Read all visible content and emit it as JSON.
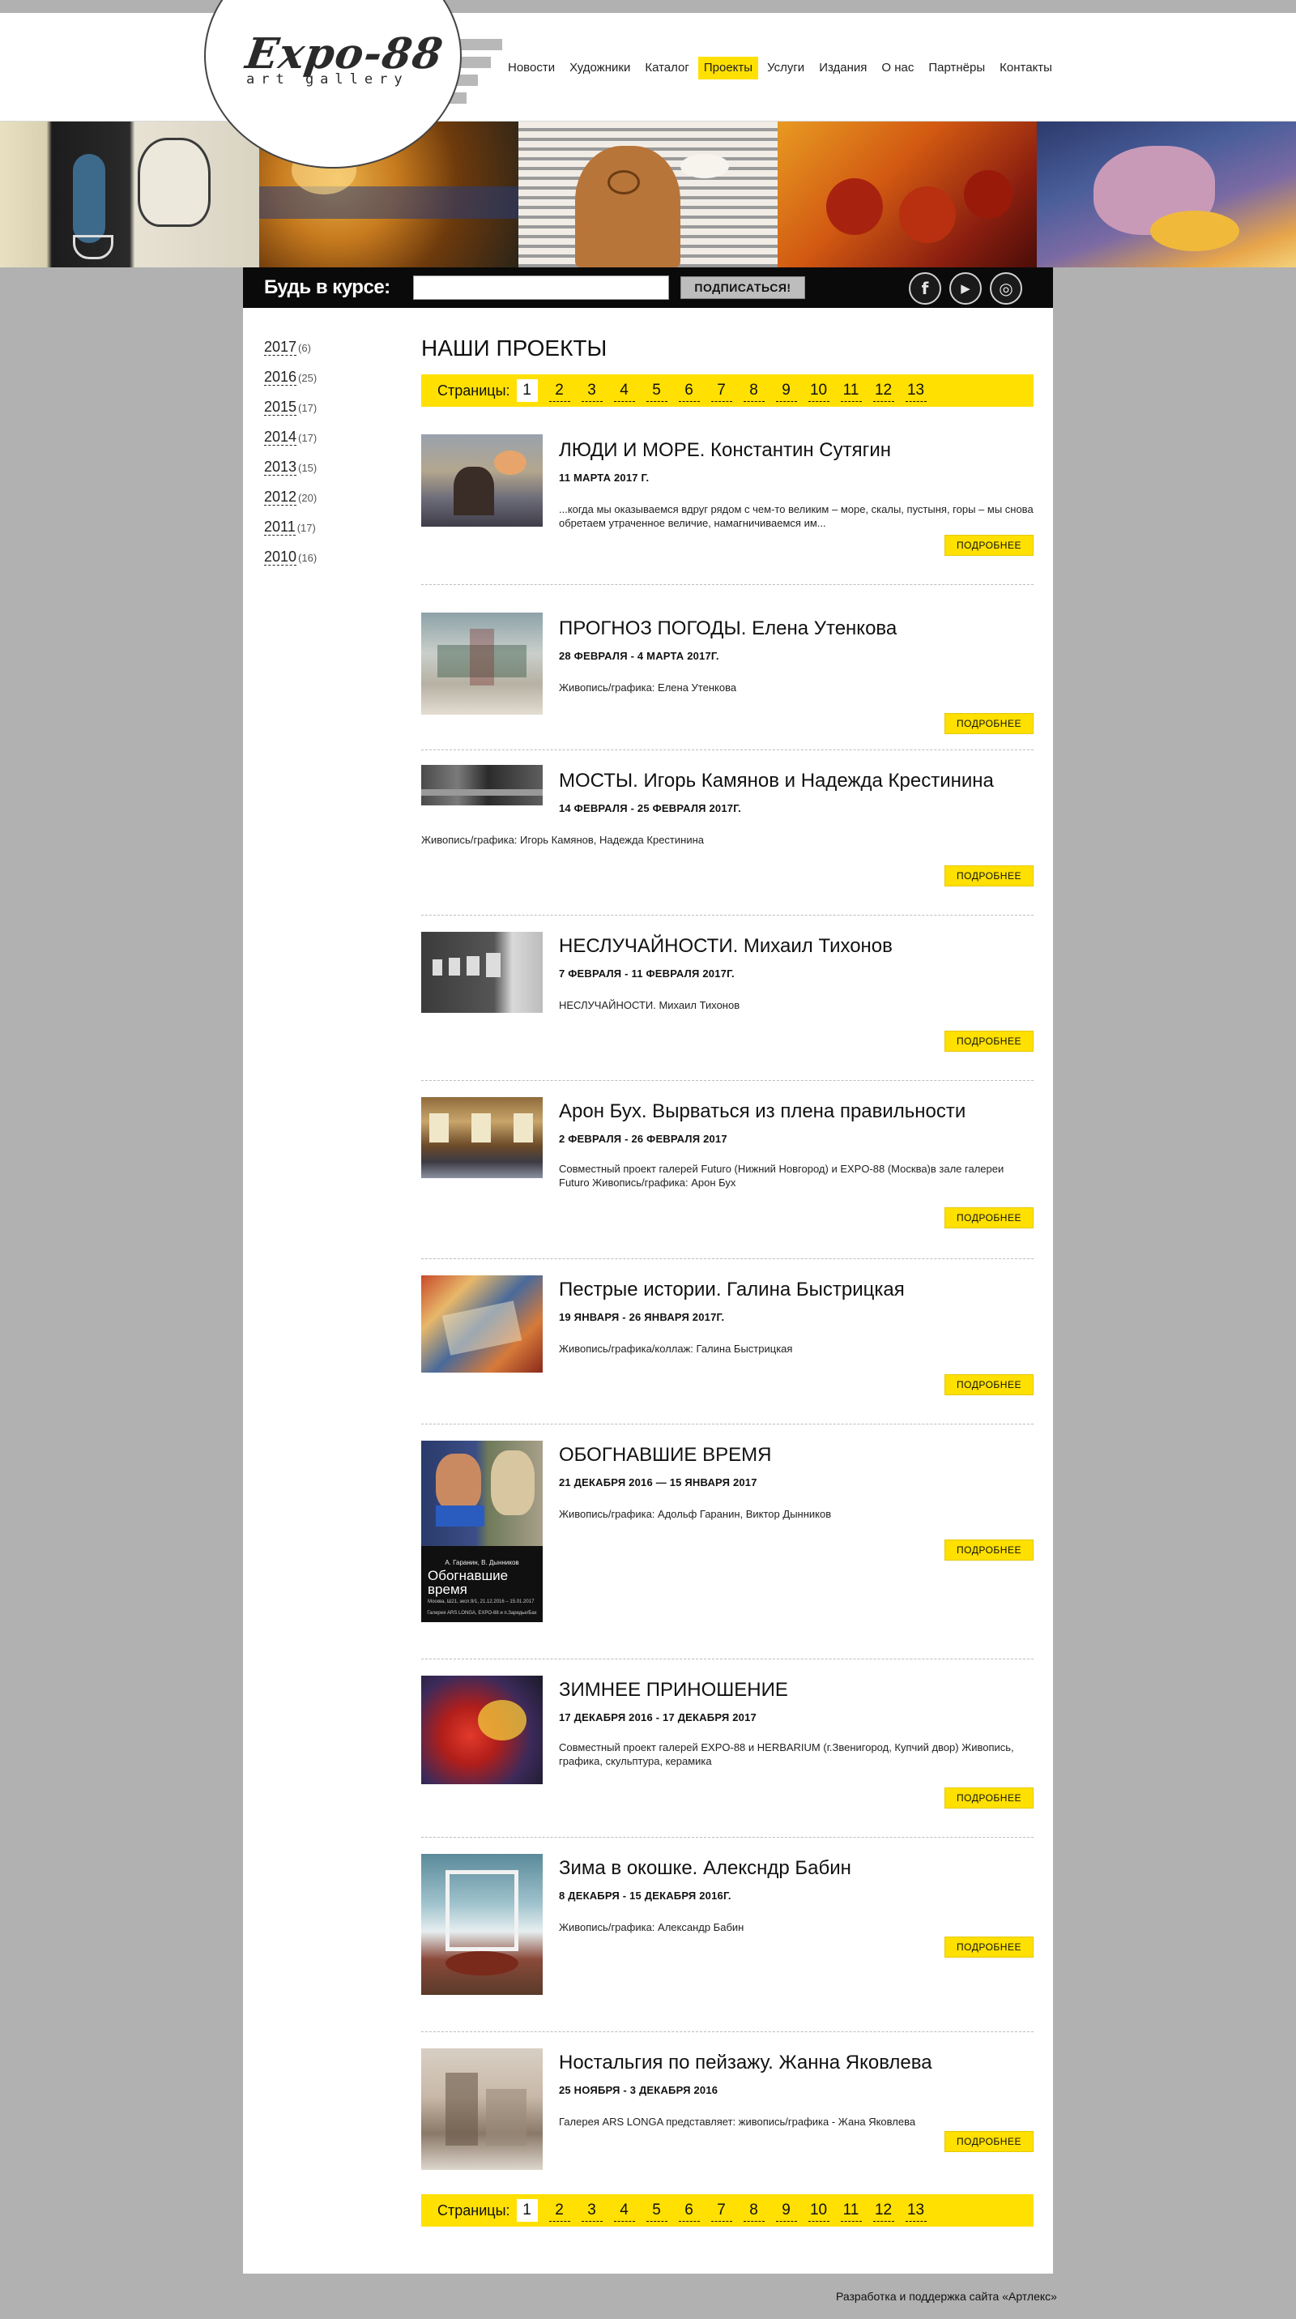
{
  "header": {
    "logo_text": "Expo-88",
    "logo_sub": "art gallery",
    "nav": [
      {
        "label": "Новости",
        "active": false
      },
      {
        "label": "Художники",
        "active": false
      },
      {
        "label": "Каталог",
        "active": false
      },
      {
        "label": "Проекты",
        "active": true
      },
      {
        "label": "Услуги",
        "active": false
      },
      {
        "label": "Издания",
        "active": false
      },
      {
        "label": "О нас",
        "active": false
      },
      {
        "label": "Партнёры",
        "active": false
      },
      {
        "label": "Контакты",
        "active": false
      }
    ]
  },
  "subscribe": {
    "label": "Будь в курсе:",
    "input_value": "",
    "button_label": "ПОДПИСАТЬСЯ!",
    "social": [
      {
        "icon": "facebook-icon",
        "glyph": "f"
      },
      {
        "icon": "youtube-icon",
        "glyph": "▶"
      },
      {
        "icon": "instagram-icon",
        "glyph": "◎"
      }
    ]
  },
  "sidebar": {
    "years": [
      {
        "year": "2017",
        "count": "(6)"
      },
      {
        "year": "2016",
        "count": "(25)"
      },
      {
        "year": "2015",
        "count": "(17)"
      },
      {
        "year": "2014",
        "count": "(17)"
      },
      {
        "year": "2013",
        "count": "(15)"
      },
      {
        "year": "2012",
        "count": "(20)"
      },
      {
        "year": "2011",
        "count": "(17)"
      },
      {
        "year": "2010",
        "count": "(16)"
      }
    ]
  },
  "main": {
    "title": "НАШИ ПРОЕКТЫ",
    "pager": {
      "label": "Страницы:",
      "pages": [
        "1",
        "2",
        "3",
        "4",
        "5",
        "6",
        "7",
        "8",
        "9",
        "10",
        "11",
        "12",
        "13"
      ],
      "current": "1"
    },
    "more_label": "ПОДРОБНЕЕ",
    "projects": [
      {
        "title": "ЛЮДИ И МОРЕ. Константин Сутягин",
        "date": "11 МАРТА 2017 Г.",
        "desc": "...когда мы оказываемся вдруг рядом с чем-то великим – море, скалы, пустыня, горы – мы снова обретаем утраченное величие, намагничиваемся им..."
      },
      {
        "title": "ПРОГНОЗ ПОГОДЫ. Елена Утенкова",
        "date": "28 ФЕВРАЛЯ - 4 МАРТА 2017Г.",
        "desc": "Живопись/графика: Елена Утенкова"
      },
      {
        "title": "МОСТЫ. Игорь Камянов и Надежда Крестинина",
        "date": "14 ФЕВРАЛЯ - 25 ФЕВРАЛЯ 2017Г.",
        "desc": "Живопись/графика: Игорь Камянов, Надежда Крестинина"
      },
      {
        "title": "НЕСЛУЧАЙНОСТИ. Михаил Тихонов",
        "date": "7 ФЕВРАЛЯ - 11 ФЕВРАЛЯ 2017Г.",
        "desc": "НЕСЛУЧАЙНОСТИ. Михаил Тихонов"
      },
      {
        "title": "Арон Бух. Вырваться из плена правильности",
        "date": "2 ФЕВРАЛЯ - 26 ФЕВРАЛЯ 2017",
        "desc": "Совместный проект галерей Futuro (Нижний Новгород) и EXPO-88 (Москва)в зале галереи Futuro Живопись/графика: Арон Бух"
      },
      {
        "title": "Пестрые истории. Галина Быстрицкая",
        "date": "19 ЯНВАРЯ - 26 ЯНВАРЯ 2017Г.",
        "desc": "Живопись/графика/коллаж: Галина Быстрицкая"
      },
      {
        "title": "ОБОГНАВШИЕ ВРЕМЯ",
        "date": "21 ДЕКАБРЯ 2016 — 15 ЯНВАРЯ 2017",
        "desc": "Живопись/графика: Адольф Гаранин, Виктор Дынников",
        "poster": {
          "names": "А. Гаранин, В. Дынников",
          "title": "Обогнавшие время",
          "dates": "Москва, Ш21, эксп.9/1, 21.12.2016 – 15.01.2017",
          "gallery": "Галерея ARS LONGA, EXPO-88 и п.Зарядье/Бах"
        }
      },
      {
        "title": "ЗИМНЕЕ ПРИНОШЕНИЕ",
        "date": "17 ДЕКАБРЯ 2016 - 17 ДЕКАБРЯ 2017",
        "desc": "Совместный проект галерей EXPO-88 и HERBARIUM (г.Звенигород, Купчий двор) Живопись, графика, скульптура, керамика"
      },
      {
        "title": "Зима в окошке. Алекснд‍р Бабин",
        "date": "8 ДЕКАБРЯ - 15 ДЕКАБРЯ 2016Г.",
        "desc": "Живопись/графика: Александр Бабин"
      },
      {
        "title": "Ностальгия по пейзажу. Жанна Яковлева",
        "date": "25 НОЯБРЯ - 3 ДЕКАБРЯ 2016",
        "desc": "Галерея ARS LONGA представляет: живопись/графика - Жана Яковлева"
      }
    ]
  },
  "footer": {
    "text": "Разработка и поддержка сайта «Артлекс»"
  }
}
